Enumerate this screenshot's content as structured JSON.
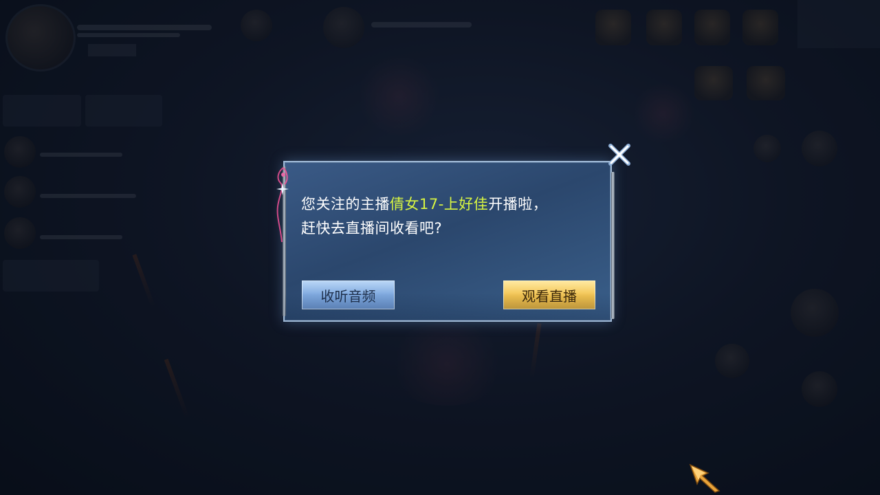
{
  "dialog": {
    "message_prefix": "您关注的主播",
    "streamer_name": "倩女17-上好佳",
    "message_suffix": "开播啦，",
    "message_line2": "赶快去直播间收看吧?",
    "listen_audio_label": "收听音频",
    "watch_live_label": "观看直播",
    "close_icon": "close-icon"
  },
  "colors": {
    "highlight": "#d8f542",
    "listen_button": "#8db4e4",
    "watch_button": "#f2c24e",
    "dialog_background": "#2f4c74"
  }
}
